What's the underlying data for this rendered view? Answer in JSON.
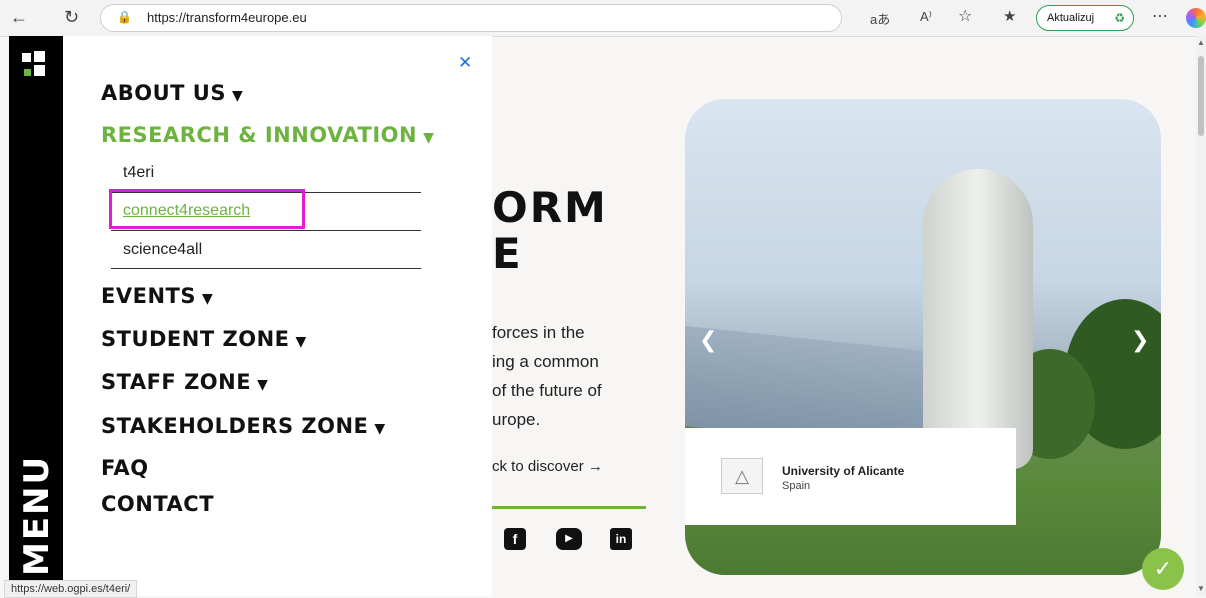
{
  "browser": {
    "url": "https://transform4europe.eu",
    "update_label": "Aktualizuj",
    "read_aloud": "A⁾",
    "translate": "aあ"
  },
  "hero": {
    "title_line1": "ORM",
    "title_line2": "E",
    "text_line1": "forces in the",
    "text_line2": "ing a common",
    "text_line3": "of the future of",
    "text_line4": "urope.",
    "discover": "ck to discover →"
  },
  "carousel": {
    "university": "University of Alicante",
    "country": "Spain"
  },
  "menu": {
    "vertical_label": "MENU",
    "items": [
      {
        "label": "ABOUT US"
      },
      {
        "label": "RESEARCH & INNOVATION"
      },
      {
        "label": "EVENTS"
      },
      {
        "label": "STUDENT ZONE"
      },
      {
        "label": "STAFF ZONE"
      },
      {
        "label": "STAKEHOLDERS ZONE"
      },
      {
        "label": "FAQ"
      },
      {
        "label": "CONTACT"
      }
    ],
    "sub_items": [
      {
        "label": "t4eri"
      },
      {
        "label": "connect4research"
      },
      {
        "label": "science4all"
      }
    ]
  },
  "status_bar": {
    "hover_url": "https://web.ogpi.es/t4eri/"
  },
  "colors": {
    "accent_green": "#6db33f",
    "highlight_magenta": "#e31ccf",
    "close_blue": "#1f6fd6"
  },
  "icons": [
    "back-icon",
    "refresh-icon",
    "lock-icon",
    "star-icon",
    "favorites-icon",
    "more-icon",
    "close-icon",
    "caret-down-icon",
    "facebook-icon",
    "youtube-icon",
    "linkedin-icon",
    "chevron-left-icon",
    "chevron-right-icon",
    "eco-badge-icon"
  ]
}
